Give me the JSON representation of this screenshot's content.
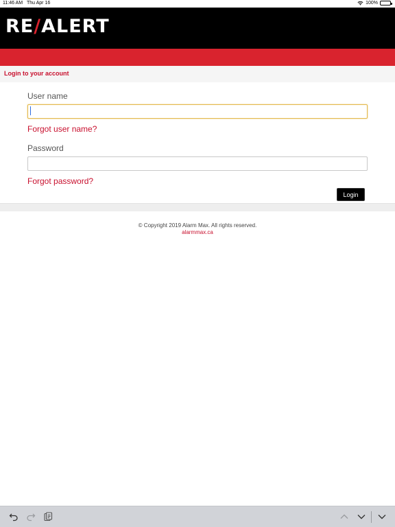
{
  "status_bar": {
    "time": "11:46 AM",
    "date": "Thu Apr 16",
    "battery": "100%",
    "icons": [
      "wifi-icon",
      "battery-icon"
    ]
  },
  "header": {
    "logo_part1": "RE",
    "logo_slash": "/",
    "logo_part2": "ALERT"
  },
  "page": {
    "title": "Login to your account"
  },
  "form": {
    "username_label": "User name",
    "username_value": "",
    "forgot_username": "Forgot user name?",
    "password_label": "Password",
    "password_value": "",
    "forgot_password": "Forgot password?",
    "login_button": "Login"
  },
  "footer": {
    "copyright": "© Copyright 2019 Alarm Max. All rights reserved.",
    "link": "alarmmax.ca"
  },
  "toolbar": {
    "icons": [
      "undo-icon",
      "redo-icon",
      "paste-icon",
      "chevron-up-icon",
      "chevron-down-icon",
      "keyboard-dismiss-icon"
    ]
  },
  "colors": {
    "brand_red": "#d9232e",
    "link_red": "#c8102e",
    "header_black": "#000000",
    "focus_border": "#e3b84a"
  }
}
